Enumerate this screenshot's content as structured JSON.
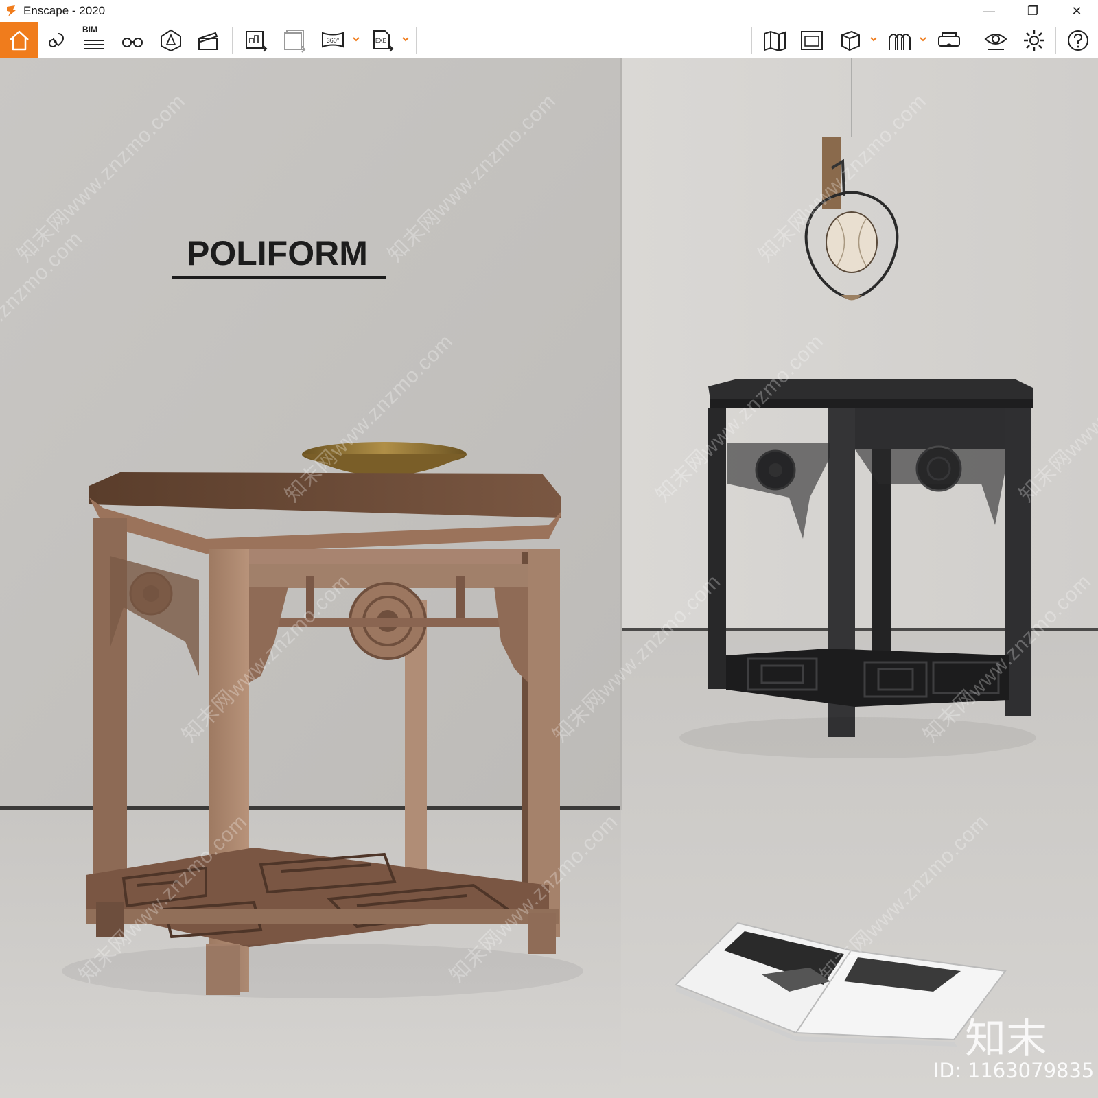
{
  "window": {
    "title": "Enscape - 2020",
    "minimize_glyph": "—",
    "restore_glyph": "❐",
    "close_glyph": "✕"
  },
  "toolbar": {
    "accent_color": "#f07c1c",
    "bim_label": "BIM",
    "btn_360_label": "360°",
    "btn_exe_label": "EXE",
    "left_buttons": [
      "home-icon",
      "map-pin-view-icon",
      "bim-icon",
      "binoculars-icon",
      "asset-library-icon",
      "clapperboard-icon",
      "screenshot-export-icon",
      "batch-render-icon",
      "panorama-360-icon",
      "exe-export-icon"
    ],
    "right_buttons": [
      "map-icon",
      "views-icon",
      "cube-icon",
      "archways-icon",
      "vr-headset-icon",
      "visual-settings-icon",
      "gear-icon",
      "help-icon"
    ]
  },
  "scene": {
    "brand_title": "POLIFORM",
    "watermark_text": "知末网www.znzmo.com",
    "logo_text": "知末",
    "model_id": "ID: 1163079835"
  }
}
